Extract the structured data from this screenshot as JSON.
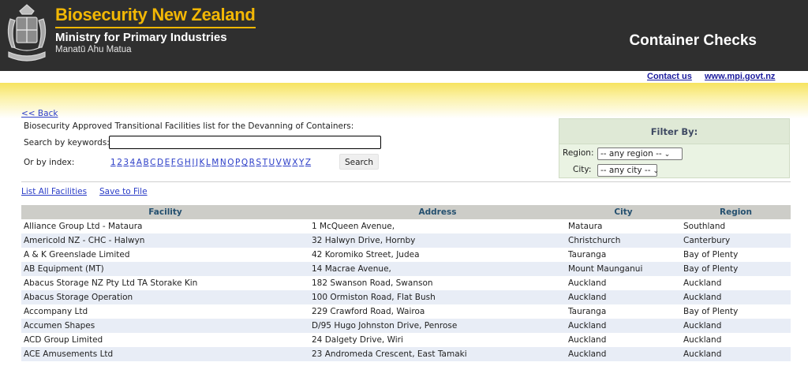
{
  "header": {
    "brand_title": "Biosecurity New Zealand",
    "ministry": "Ministry for Primary Industries",
    "maori_name": "Manatū Ahu Matua",
    "app_title": "Container Checks"
  },
  "top_links": {
    "contact": "Contact us",
    "website": "www.mpi.govt.nz"
  },
  "back_link": "<< Back",
  "subtitle": "Biosecurity Approved Transitional Facilities list for the Devanning of Containers:",
  "search": {
    "keywords_label": "Search by keywords:",
    "keywords_value": "",
    "index_label": "Or by index:",
    "button_label": "Search"
  },
  "index_items": [
    "1",
    "2",
    "3",
    "4",
    "A",
    "B",
    "C",
    "D",
    "E",
    "F",
    "G",
    "H",
    "I",
    "J",
    "K",
    "L",
    "M",
    "N",
    "O",
    "P",
    "Q",
    "R",
    "S",
    "T",
    "U",
    "V",
    "W",
    "X",
    "Y",
    "Z"
  ],
  "filter": {
    "heading": "Filter By:",
    "region_label": "Region:",
    "region_value": "-- any region --",
    "city_label": "City:",
    "city_value": "-- any city --"
  },
  "actions": {
    "list_all": "List All Facilities",
    "save": "Save to File"
  },
  "table": {
    "columns": [
      "Facility",
      "Address",
      "City",
      "Region"
    ],
    "rows": [
      [
        "Alliance Group Ltd - Mataura",
        "1 McQueen Avenue,",
        "Mataura",
        "Southland"
      ],
      [
        "Americold NZ - CHC - Halwyn",
        "32 Halwyn Drive, Hornby",
        "Christchurch",
        "Canterbury"
      ],
      [
        "A & K Greenslade Limited",
        "42 Koromiko Street, Judea",
        "Tauranga",
        "Bay of Plenty"
      ],
      [
        "AB Equipment (MT)",
        "14 Macrae Avenue,",
        "Mount Maunganui",
        "Bay of Plenty"
      ],
      [
        "Abacus Storage NZ Pty Ltd TA Storake Kin",
        "182 Swanson Road, Swanson",
        "Auckland",
        "Auckland"
      ],
      [
        "Abacus Storage Operation",
        "100 Ormiston Road, Flat Bush",
        "Auckland",
        "Auckland"
      ],
      [
        "Accompany Ltd",
        "229 Crawford Road, Wairoa",
        "Tauranga",
        "Bay of Plenty"
      ],
      [
        "Accumen Shapes",
        "D/95 Hugo Johnston Drive, Penrose",
        "Auckland",
        "Auckland"
      ],
      [
        "ACD Group Limited",
        "24 Dalgety Drive, Wiri",
        "Auckland",
        "Auckland"
      ],
      [
        "ACE Amusements Ltd",
        "23 Andromeda Crescent, East Tamaki",
        "Auckland",
        "Auckland"
      ]
    ]
  },
  "colors": {
    "header_bg": "#2f2f2f",
    "brand_gold": "#f2b705",
    "table_header_bg": "#cdcdc8",
    "row_alt_bg": "#e8edf6",
    "filter_bg": "#eaf3e3"
  }
}
